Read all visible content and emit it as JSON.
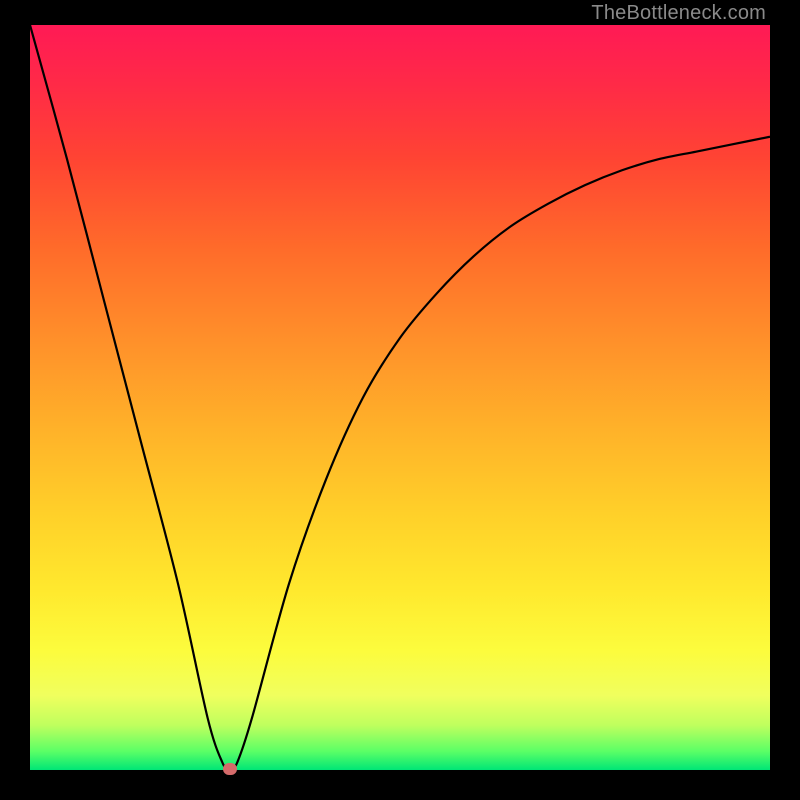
{
  "credit": "TheBottleneck.com",
  "chart_data": {
    "type": "line",
    "title": "",
    "xlabel": "",
    "ylabel": "",
    "xlim": [
      0,
      100
    ],
    "ylim": [
      0,
      100
    ],
    "series": [
      {
        "name": "bottleneck-curve",
        "x": [
          0,
          5,
          10,
          15,
          20,
          24,
          26,
          27,
          28,
          30,
          35,
          40,
          45,
          50,
          55,
          60,
          65,
          70,
          75,
          80,
          85,
          90,
          95,
          100
        ],
        "values": [
          100,
          82,
          63,
          44,
          25,
          7,
          1,
          0,
          1,
          7,
          25,
          39,
          50,
          58,
          64,
          69,
          73,
          76,
          78.5,
          80.5,
          82,
          83,
          84,
          85
        ]
      }
    ],
    "marker": {
      "x": 27,
      "y": 0,
      "name": "optimal-point"
    },
    "background": {
      "type": "vertical-gradient",
      "stops": [
        {
          "pos": 0,
          "color": "#ff1a55"
        },
        {
          "pos": 0.18,
          "color": "#ff4433"
        },
        {
          "pos": 0.42,
          "color": "#ff8f2a"
        },
        {
          "pos": 0.66,
          "color": "#ffd129"
        },
        {
          "pos": 0.84,
          "color": "#fcfc3d"
        },
        {
          "pos": 0.94,
          "color": "#bfff5e"
        },
        {
          "pos": 1.0,
          "color": "#00e676"
        }
      ]
    }
  },
  "colors": {
    "frame": "#000000",
    "curve": "#000000",
    "marker": "#d46a6a",
    "credit_text": "#8a8a8a"
  }
}
